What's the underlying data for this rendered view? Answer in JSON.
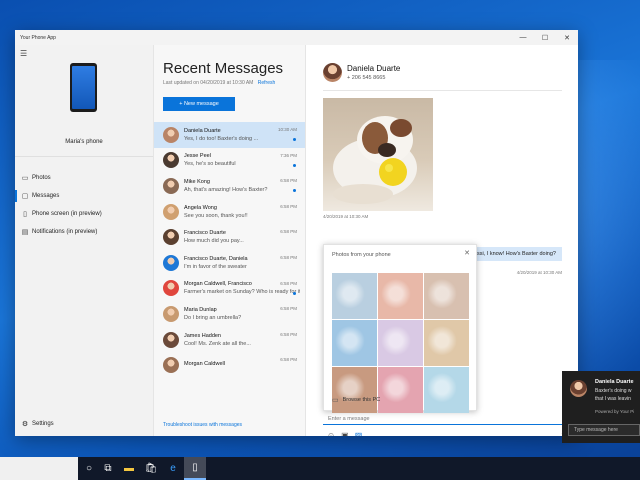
{
  "window": {
    "title": "Your Phone App",
    "controls": [
      "—",
      "☐",
      "✕"
    ]
  },
  "left": {
    "phone_name": "Maria's phone",
    "nav": [
      {
        "label": "Photos",
        "icon": "photos-icon",
        "glyph": "▭"
      },
      {
        "label": "Messages",
        "icon": "messages-icon",
        "glyph": "▢"
      },
      {
        "label": "Phone screen (in preview)",
        "icon": "phone-screen-icon",
        "glyph": "▯"
      },
      {
        "label": "Notifications (in preview)",
        "icon": "notifications-icon",
        "glyph": "▤"
      }
    ],
    "active_index": 1,
    "settings_label": "Settings"
  },
  "middle": {
    "title": "Recent Messages",
    "updated": "Last updated on 04/20/2019 at 10:30 AM",
    "refresh": "Refresh",
    "new_message": "+ New message",
    "troubleshoot": "Troubleshoot issues with messages",
    "conversations": [
      {
        "name": "Daniela Duarte",
        "preview": "Yes, I do too! Baxter's doing ...",
        "time": "10:30 AM",
        "unread": true,
        "selected": true,
        "color": "#b98466"
      },
      {
        "name": "Jesse Peel",
        "preview": "Yes, he's so beautiful",
        "time": "7:36 PM",
        "unread": true,
        "selected": false,
        "color": "#4a3a30"
      },
      {
        "name": "Mike Kong",
        "preview": "Ah, that's amazing! How's Baxter?",
        "time": "6:58 PM",
        "unread": true,
        "selected": false,
        "color": "#8a6a55"
      },
      {
        "name": "Angela Wong",
        "preview": "See you soon, thank you!!",
        "time": "6:58 PM",
        "unread": false,
        "selected": false,
        "color": "#d0a070"
      },
      {
        "name": "Francisco Duarte",
        "preview": "How much did you pay...",
        "time": "6:58 PM",
        "unread": false,
        "selected": false,
        "color": "#5b4030"
      },
      {
        "name": "Francisco Duarte, Daniela",
        "preview": "I'm in favor of the sweater",
        "time": "6:58 PM",
        "unread": false,
        "selected": false,
        "color": "#1e78d6"
      },
      {
        "name": "Morgan Caldwell, Francisco",
        "preview": "Farmer's market on Sunday? Who is ready for it?",
        "time": "6:58 PM",
        "unread": true,
        "selected": false,
        "color": "#e0463d"
      },
      {
        "name": "Maria Dunlap",
        "preview": "Do I bring an umbrella?",
        "time": "6:58 PM",
        "unread": false,
        "selected": false,
        "color": "#c89a70"
      },
      {
        "name": "James Hadden",
        "preview": "Cool! Ms. Zenk ate all the...",
        "time": "6:58 PM",
        "unread": false,
        "selected": false,
        "color": "#6b4a3a"
      },
      {
        "name": "Morgan Caldwell",
        "preview": "",
        "time": "6:58 PM",
        "unread": false,
        "selected": false,
        "color": "#9a7055"
      }
    ]
  },
  "conversation": {
    "contact": "Daniela Duarte",
    "phone": "+ 206 545 8665",
    "image_timestamp": "4/20/2019 at 10:30 AM",
    "bubble_text": "ssi, I know! How's Baxter doing?",
    "bubble_timestamp": "4/20/2019 at 10:30 AM",
    "compose_placeholder": "Enter a message",
    "picker": {
      "title": "Photos from your phone",
      "browse": "Browse this PC",
      "tiles": [
        "#b9cfe0",
        "#e8b8a8",
        "#d8c0b0",
        "#9fc6e4",
        "#d9c9e4",
        "#e0c8a8",
        "#c89a80",
        "#e4a4b0",
        "#b4d8e8"
      ]
    }
  },
  "toast": {
    "name": "Daniela Duarte",
    "line1": "Baxter's doing w",
    "line2": "that I was leavin",
    "powered": "Powered by Your Pi",
    "placeholder": "Type message here"
  },
  "taskbar": {
    "icons": [
      "cortana-icon",
      "task-view-icon",
      "file-explorer-icon",
      "store-icon",
      "edge-icon",
      "your-phone-icon"
    ]
  }
}
